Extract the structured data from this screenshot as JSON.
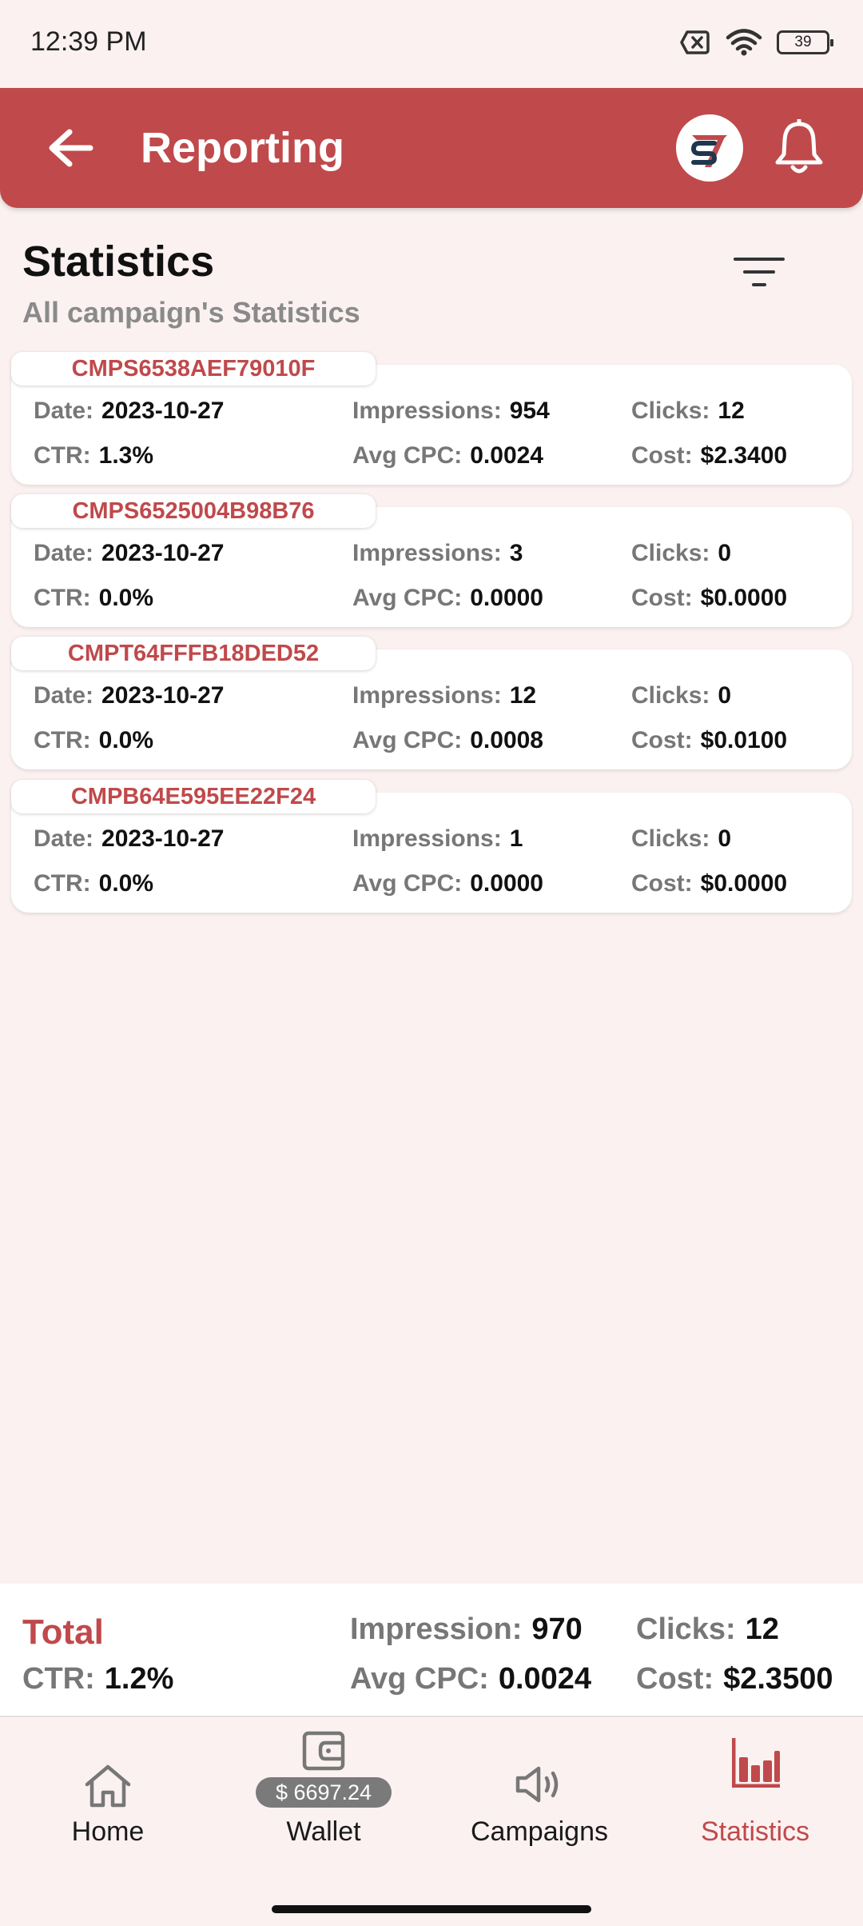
{
  "status_bar": {
    "time": "12:39 PM",
    "battery": "39"
  },
  "app_bar": {
    "title": "Reporting",
    "logo_text": "S7"
  },
  "header": {
    "title": "Statistics",
    "subtitle": "All campaign's Statistics"
  },
  "labels": {
    "date": "Date:",
    "impressions": "Impressions:",
    "clicks": "Clicks:",
    "ctr": "CTR:",
    "avg_cpc": "Avg CPC:",
    "cost": "Cost:"
  },
  "campaigns": [
    {
      "id": "CMPS6538AEF79010F",
      "date": "2023-10-27",
      "impressions": "954",
      "clicks": "12",
      "ctr": "1.3%",
      "avg_cpc": "0.0024",
      "cost": "$2.3400"
    },
    {
      "id": "CMPS6525004B98B76",
      "date": "2023-10-27",
      "impressions": "3",
      "clicks": "0",
      "ctr": "0.0%",
      "avg_cpc": "0.0000",
      "cost": "$0.0000"
    },
    {
      "id": "CMPT64FFFB18DED52",
      "date": "2023-10-27",
      "impressions": "12",
      "clicks": "0",
      "ctr": "0.0%",
      "avg_cpc": "0.0008",
      "cost": "$0.0100"
    },
    {
      "id": "CMPB64E595EE22F24",
      "date": "2023-10-27",
      "impressions": "1",
      "clicks": "0",
      "ctr": "0.0%",
      "avg_cpc": "0.0000",
      "cost": "$0.0000"
    }
  ],
  "total": {
    "label": "Total",
    "ctr_label": "CTR:",
    "ctr": "1.2%",
    "impression_label": "Impression:",
    "impression": "970",
    "avg_cpc_label": "Avg CPC:",
    "avg_cpc": "0.0024",
    "clicks_label": "Clicks:",
    "clicks": "12",
    "cost_label": "Cost:",
    "cost": "$2.3500"
  },
  "nav": {
    "home": "Home",
    "wallet": "Wallet",
    "wallet_balance": "$ 6697.24",
    "campaigns": "Campaigns",
    "statistics": "Statistics",
    "active": "statistics"
  },
  "colors": {
    "brand": "#c0494b",
    "background": "#fbf1f1"
  }
}
